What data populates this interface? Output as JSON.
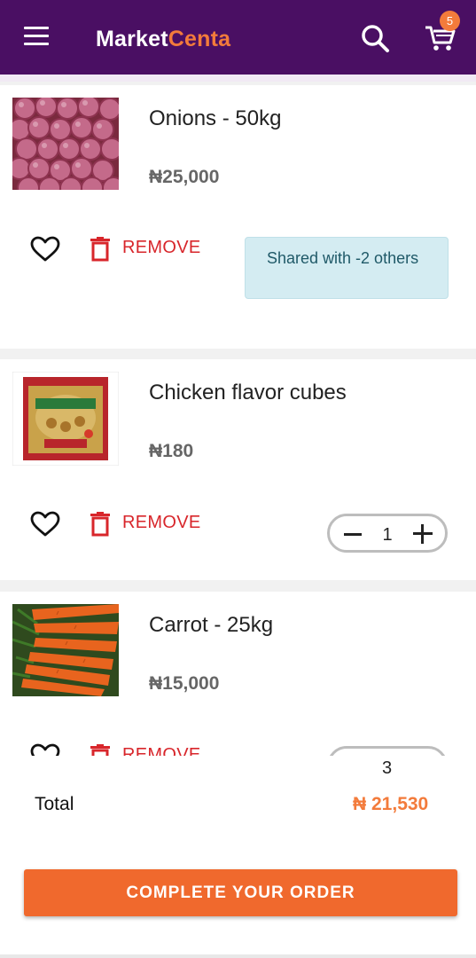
{
  "appbar": {
    "brand_part1": "Market",
    "brand_part2": "Centa",
    "cart_count": "5",
    "colors": {
      "bar": "#4a0f63",
      "accent": "#f37b3b"
    }
  },
  "cart": {
    "items": [
      {
        "name": "Onions - 50kg",
        "price": "₦25,000",
        "remove_label": "REMOVE",
        "shared_text": "Shared with -2 others"
      },
      {
        "name": "Chicken flavor cubes",
        "price": "₦180",
        "remove_label": "REMOVE",
        "quantity": "1"
      },
      {
        "name": "Carrot - 25kg",
        "price": "₦15,000",
        "remove_label": "REMOVE",
        "quantity": "3"
      }
    ]
  },
  "footer": {
    "total_label": "Total",
    "total_value": "₦ 21,530",
    "checkout_label": "COMPLETE YOUR ORDER"
  }
}
